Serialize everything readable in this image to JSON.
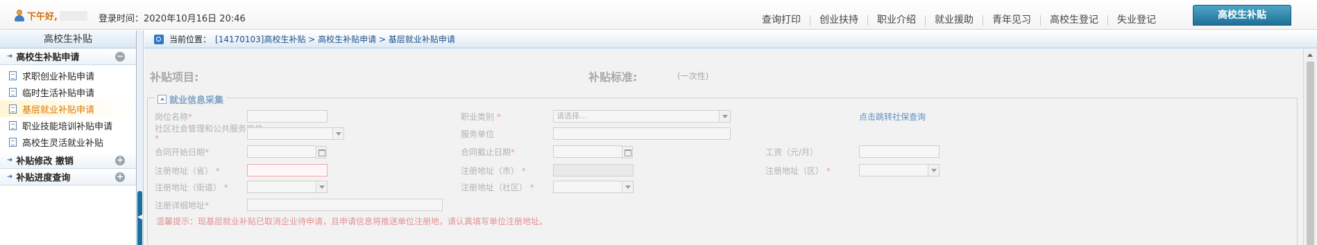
{
  "topbar": {
    "greeting": "下午好,",
    "login_time_label": "登录时间：2020年10月16日 20:46",
    "nav": [
      "查询打印",
      "创业扶持",
      "职业介绍",
      "就业援助",
      "青年见习",
      "高校生登记",
      "失业登记"
    ],
    "active_tab": "高校生补贴"
  },
  "sidebar": {
    "title": "高校生补贴",
    "groups": [
      {
        "label": "高校生补贴申请",
        "toggle": "−",
        "items": [
          "求职创业补贴申请",
          "临时生活补贴申请",
          "基层就业补贴申请",
          "职业技能培训补贴申请",
          "高校生灵活就业补贴"
        ]
      },
      {
        "label": "补贴修改 撤销",
        "toggle": "+"
      },
      {
        "label": "补贴进度查询",
        "toggle": "+"
      }
    ]
  },
  "breadcrumb": {
    "label": "当前位置：",
    "path": "[14170103]高校生补贴 > 高校生补贴申请 > 基层就业补贴申请"
  },
  "form": {
    "subsidy_item_label": "补贴项目:",
    "subsidy_standard_label": "补贴标准:",
    "one_time": "(一次性)",
    "section_title": "就业信息采集",
    "position_name": "岗位名称",
    "job_category": "职业类别",
    "job_category_placeholder": "请选择...",
    "social_security_link": "点击跳转社保查询",
    "community_post": "社区社会管理和公共服务岗位",
    "employer": "服务单位",
    "contract_start": "合同开始日期",
    "contract_end": "合同截止日期",
    "salary": "工资（元/月）",
    "reg_province": "注册地址（省）",
    "reg_city": "注册地址（市）",
    "reg_district": "注册地址（区）",
    "reg_street": "注册地址（街道）",
    "reg_community": "注册地址（社区）",
    "reg_detail": "注册详细地址",
    "required_mark": "*",
    "tip": "温馨提示：现基层就业补贴已取消企业待申请，且申请信息将推送单位注册地，请认真填写单位注册地址。"
  }
}
